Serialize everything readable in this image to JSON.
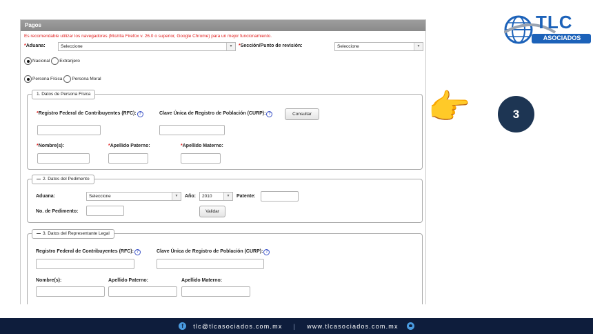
{
  "panel": {
    "title": "Pagos",
    "warning": "Es recomendable utilizar los navegadores (Mozilla Firefox v. 26.0 o superior, Google Chrome) para un mejor funcionamiento."
  },
  "top": {
    "aduana_label": "Aduana:",
    "aduana_value": "Seleccione",
    "seccion_label": "Sección/Punto de revisión:",
    "seccion_value": "Seleccione",
    "origin_options": [
      "Nacional",
      "Extranjero"
    ],
    "origin_selected": "Nacional",
    "persona_options": [
      "Persona Física",
      "Persona Moral"
    ],
    "persona_selected": "Persona Física"
  },
  "section1": {
    "legend": "1. Datos de Persona Física",
    "rfc_label": "Registro Federal de Contribuyentes (RFC):",
    "curp_label": "Clave Única de Registro de Población (CURP):",
    "consultar_button": "Consultar",
    "nombre_label": "Nombre(s):",
    "paterno_label": "Apellido Paterno:",
    "materno_label": "Apellido Materno:"
  },
  "section2": {
    "legend": "2. Datos del Pedimento",
    "aduana_label": "Aduana:",
    "aduana_value": "Seleccione",
    "anio_label": "Año:",
    "anio_value": "2010",
    "patente_label": "Patente:",
    "pedimento_label": "No. de Pedimento:",
    "validar_button": "Validar"
  },
  "section3": {
    "legend": "3. Datos del Representante Legal",
    "rfc_label": "Registro Federal de Contribuyentes (RFC):",
    "curp_label": "Clave Única de Registro de Población (CURP):",
    "nombre_label": "Nombre(s):",
    "paterno_label": "Apellido Paterno:",
    "materno_label": "Apellido Materno:"
  },
  "help_glyph": "?",
  "required_mark": "*",
  "logo": {
    "brand": "TLC",
    "sub": "ASOCIADOS"
  },
  "step": {
    "number": "3",
    "pointer_icon": "backhand-index-pointing-right-icon"
  },
  "footer": {
    "email": "tlc@tlcasociados.com.mx",
    "separator": "|",
    "website": "www.tlcasociados.com.mx",
    "facebook_glyph": "f"
  },
  "colors": {
    "footer_bg": "#0e1d3c",
    "badge_bg": "#1d3553",
    "required": "#e0201f",
    "logo_blue": "#1c62b9"
  }
}
